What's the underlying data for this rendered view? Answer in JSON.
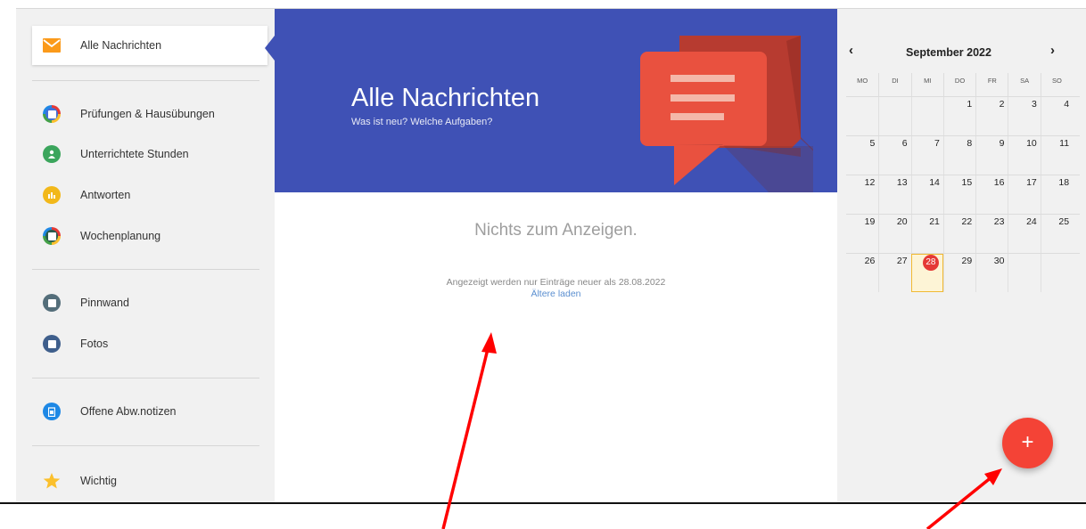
{
  "sidebar": {
    "items": [
      {
        "label": "Alle Nachrichten",
        "icon": "mail-icon",
        "active": true
      },
      {
        "label": "Prüfungen & Hausübungen",
        "icon": "exam-icon",
        "color": "#3f6fd8"
      },
      {
        "label": "Unterrichtete Stunden",
        "icon": "person-icon",
        "color": "#3ba55c"
      },
      {
        "label": "Antworten",
        "icon": "chart-icon",
        "color": "#f2b81a"
      },
      {
        "label": "Wochenplanung",
        "icon": "calendar-icon",
        "color": "#2a8c5c"
      },
      {
        "label": "Pinnwand",
        "icon": "pin-board-icon",
        "color": "#546e7a"
      },
      {
        "label": "Fotos",
        "icon": "photo-icon",
        "color": "#3f5f8c"
      },
      {
        "label": "Offene Abw.notizen",
        "icon": "clipboard-icon",
        "color": "#1e88e5"
      },
      {
        "label": "Wichtig",
        "icon": "star-icon",
        "color": "#fbc02d"
      }
    ]
  },
  "banner": {
    "title": "Alle Nachrichten",
    "subtitle": "Was ist neu? Welche Aufgaben?",
    "color": "#3f51b5"
  },
  "main": {
    "empty_text": "Nichts zum Anzeigen.",
    "info_text": "Angezeigt werden nur Einträge neuer als 28.08.2022",
    "load_link": "Ältere laden"
  },
  "calendar": {
    "month": "September 2022",
    "prev": "‹",
    "next": "›",
    "weekdays": [
      "MO",
      "DI",
      "MI",
      "DO",
      "FR",
      "SA",
      "SO"
    ],
    "weeks": [
      [
        "",
        "",
        "",
        "1",
        "2",
        "3",
        "4"
      ],
      [
        "5",
        "6",
        "7",
        "8",
        "9",
        "10",
        "11"
      ],
      [
        "12",
        "13",
        "14",
        "15",
        "16",
        "17",
        "18"
      ],
      [
        "19",
        "20",
        "21",
        "22",
        "23",
        "24",
        "25"
      ],
      [
        "26",
        "27",
        "28",
        "29",
        "30",
        "",
        ""
      ]
    ],
    "today": "28"
  },
  "fab": {
    "label": "+",
    "color": "#f44336"
  },
  "accent": "#3f51b5"
}
